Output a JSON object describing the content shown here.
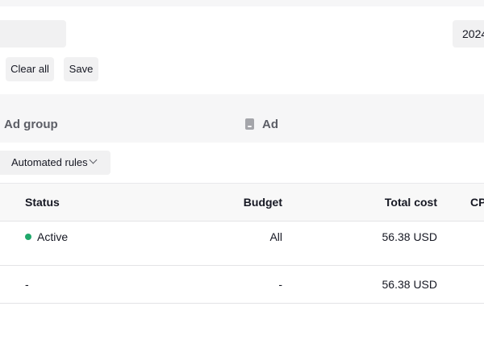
{
  "toolbar": {
    "date_value": "2024",
    "clear_label": "Clear all",
    "save_label": "Save"
  },
  "tabs": [
    {
      "label": "Ad group"
    },
    {
      "label": "Ad",
      "icon": "ad-icon"
    }
  ],
  "rules": {
    "label": "Automated rules",
    "icon": "chevron-down-icon"
  },
  "table": {
    "columns": [
      "Status",
      "Budget",
      "Total cost",
      "CP"
    ],
    "rows": [
      {
        "status": "Active",
        "status_color": "#20a86b",
        "budget": "All",
        "total_cost": "56.38 USD"
      },
      {
        "status": "-",
        "budget": "-",
        "total_cost": "56.38 USD"
      }
    ]
  }
}
